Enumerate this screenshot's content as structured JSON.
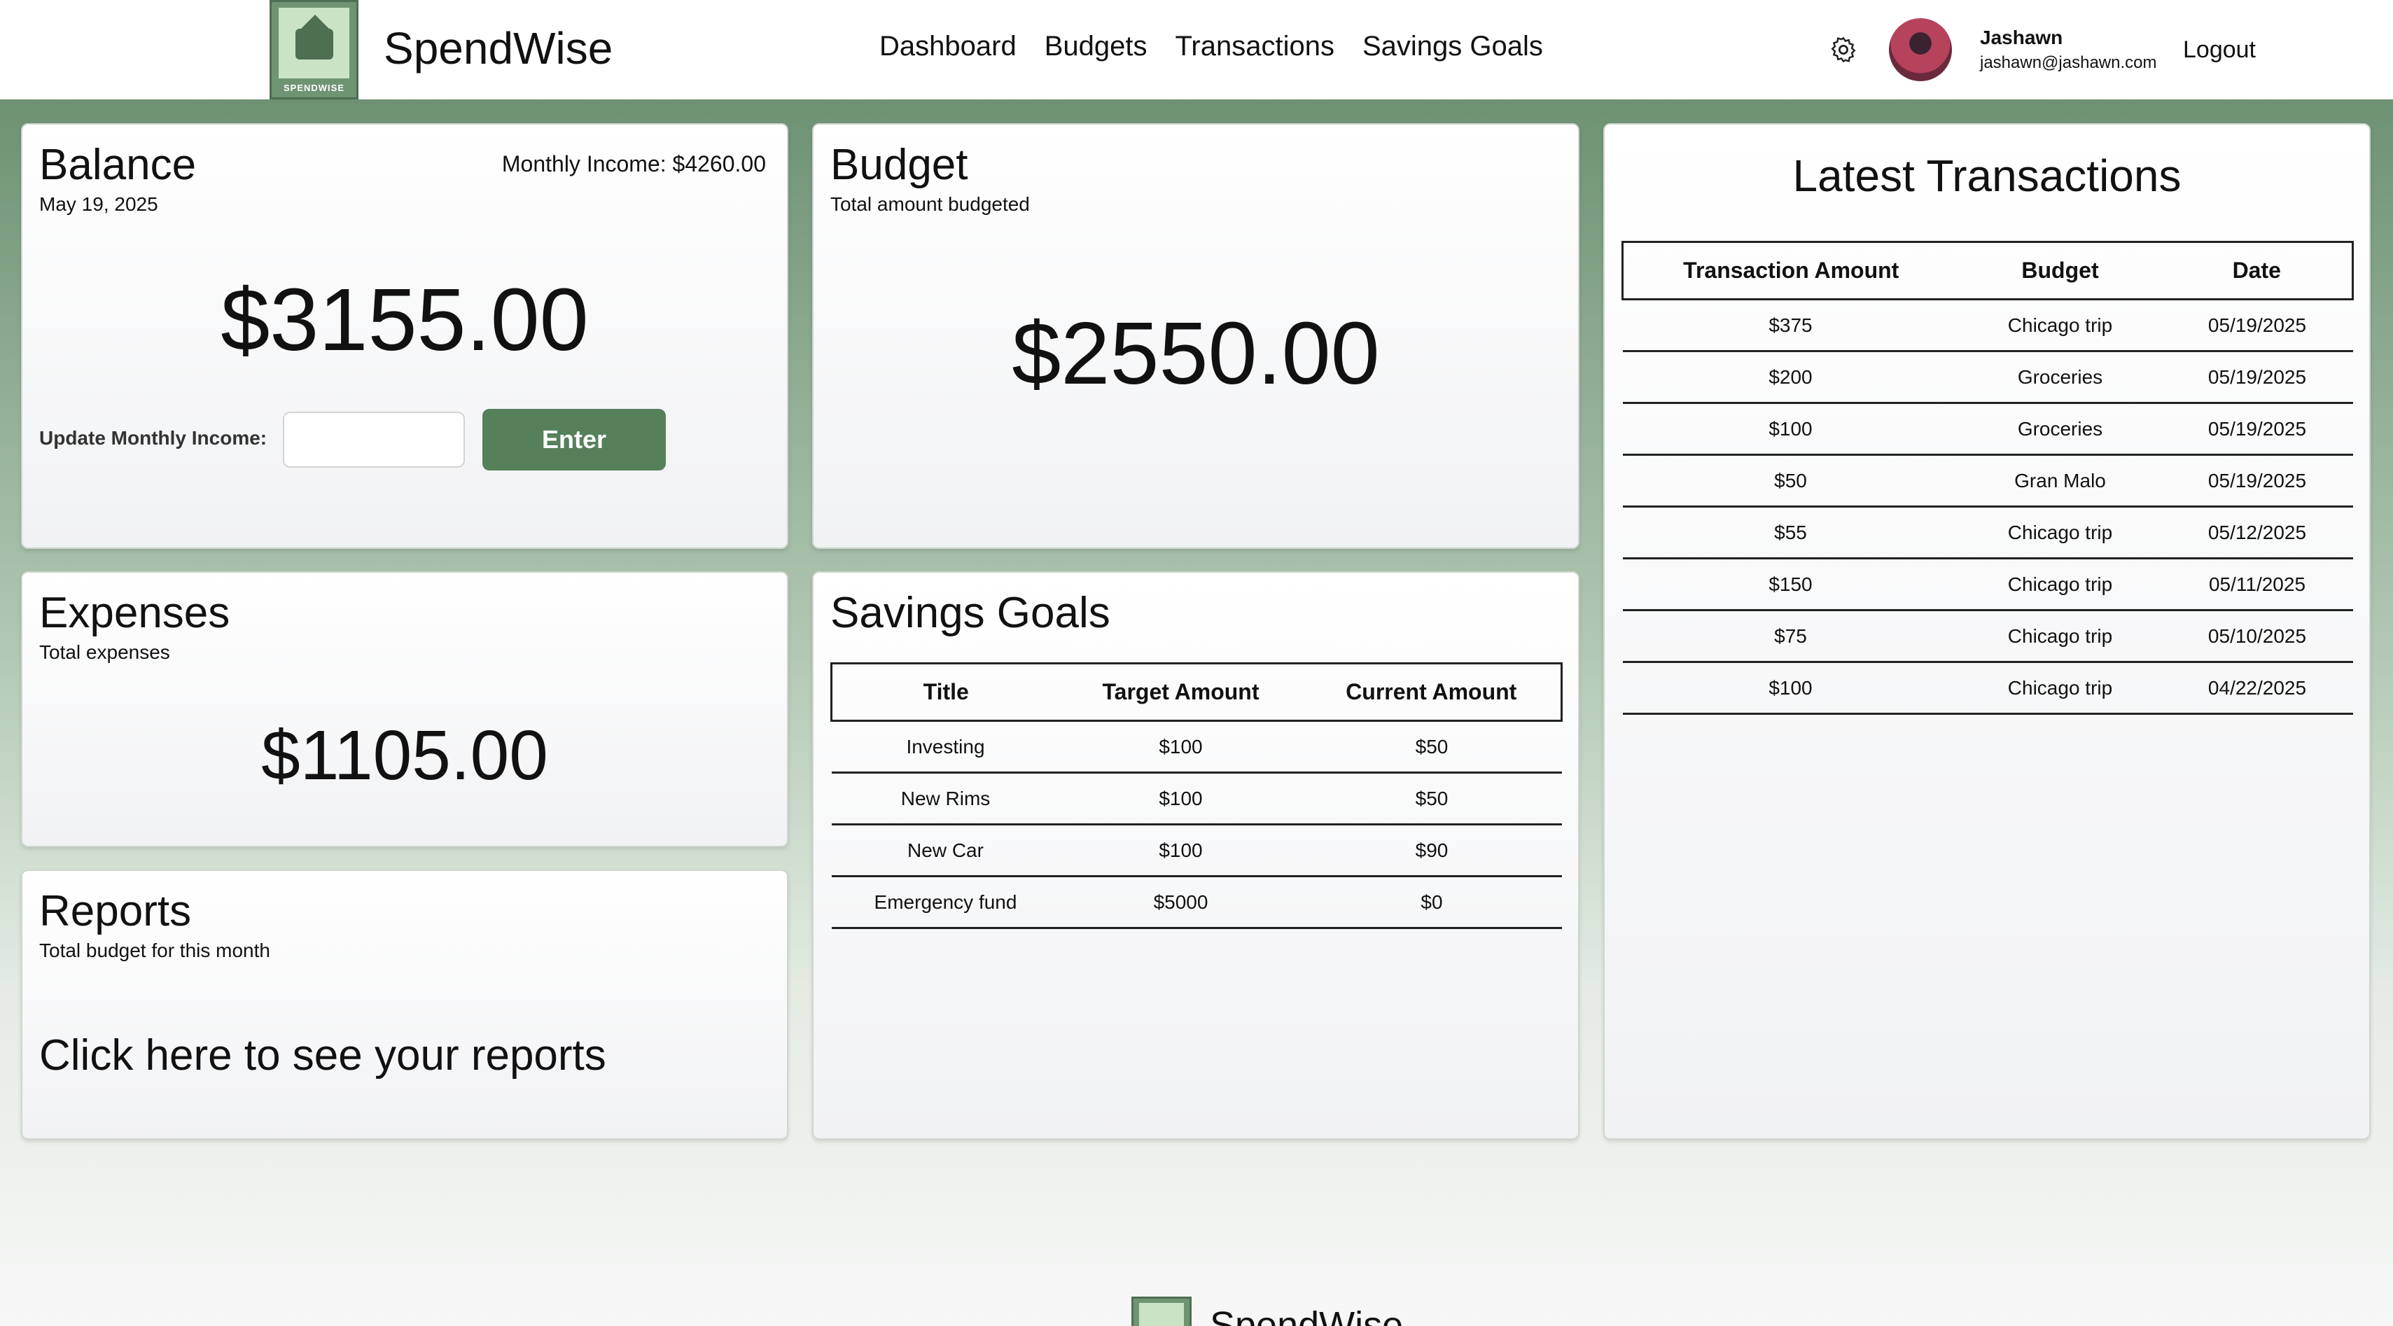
{
  "header": {
    "logo_text": "SPENDWISE",
    "brand": "SpendWise",
    "nav": [
      "Dashboard",
      "Budgets",
      "Transactions",
      "Savings Goals"
    ],
    "user_name": "Jashawn",
    "user_email": "jashawn@jashawn.com",
    "logout": "Logout"
  },
  "balance": {
    "title": "Balance",
    "date": "May 19, 2025",
    "monthly_income": "Monthly Income: $4260.00",
    "amount": "$3155.00",
    "update_label": "Update Monthly Income:",
    "input_value": "",
    "enter_label": "Enter"
  },
  "budget": {
    "title": "Budget",
    "subtitle": "Total amount budgeted",
    "amount": "$2550.00"
  },
  "expenses": {
    "title": "Expenses",
    "subtitle": "Total expenses",
    "amount": "$1105.00"
  },
  "reports": {
    "title": "Reports",
    "subtitle": "Total budget for this month",
    "link": "Click here to see your reports"
  },
  "savings_goals": {
    "title": "Savings Goals",
    "headers": [
      "Title",
      "Target Amount",
      "Current Amount"
    ],
    "rows": [
      [
        "Investing",
        "$100",
        "$50"
      ],
      [
        "New Rims",
        "$100",
        "$50"
      ],
      [
        "New Car",
        "$100",
        "$90"
      ],
      [
        "Emergency fund",
        "$5000",
        "$0"
      ]
    ]
  },
  "latest_transactions": {
    "title": "Latest Transactions",
    "headers": [
      "Transaction Amount",
      "Budget",
      "Date"
    ],
    "rows": [
      [
        "$375",
        "Chicago trip",
        "05/19/2025"
      ],
      [
        "$200",
        "Groceries",
        "05/19/2025"
      ],
      [
        "$100",
        "Groceries",
        "05/19/2025"
      ],
      [
        "$50",
        "Gran Malo",
        "05/19/2025"
      ],
      [
        "$55",
        "Chicago trip",
        "05/12/2025"
      ],
      [
        "$150",
        "Chicago trip",
        "05/11/2025"
      ],
      [
        "$75",
        "Chicago trip",
        "05/10/2025"
      ],
      [
        "$100",
        "Chicago trip",
        "04/22/2025"
      ]
    ]
  },
  "footer": {
    "brand": "SpendWise"
  },
  "icons": {
    "settings": "gear-icon",
    "avatar": "avatar"
  },
  "colors": {
    "accent": "#56805a",
    "header_bg": "#ffffff",
    "background_top": "#6d9173"
  }
}
